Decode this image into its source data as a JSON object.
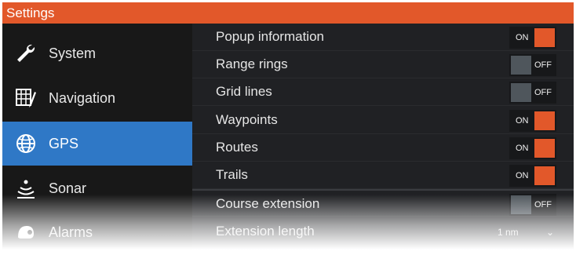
{
  "window": {
    "title": "Settings"
  },
  "sidebar": {
    "items": [
      {
        "label": "System",
        "icon": "wrench-icon",
        "active": false
      },
      {
        "label": "Navigation",
        "icon": "chart-pencil-icon",
        "active": false
      },
      {
        "label": "GPS",
        "icon": "globe-icon",
        "active": true
      },
      {
        "label": "Sonar",
        "icon": "sonar-icon",
        "active": false
      },
      {
        "label": "Alarms",
        "icon": "alarm-icon",
        "active": false
      }
    ]
  },
  "settings": {
    "rows": [
      {
        "label": "Popup information",
        "control": "toggle",
        "state": "ON"
      },
      {
        "label": "Range rings",
        "control": "toggle",
        "state": "OFF"
      },
      {
        "label": "Grid lines",
        "control": "toggle",
        "state": "OFF"
      },
      {
        "label": "Waypoints",
        "control": "toggle",
        "state": "ON"
      },
      {
        "label": "Routes",
        "control": "toggle",
        "state": "ON"
      },
      {
        "label": "Trails",
        "control": "toggle",
        "state": "ON"
      },
      {
        "label": "Course extension",
        "control": "toggle",
        "state": "OFF"
      },
      {
        "label": "Extension length",
        "control": "dropdown",
        "value": "1 nm"
      }
    ]
  },
  "colors": {
    "accent": "#e2582a",
    "active_nav": "#2f78c6",
    "toggle_off_knob": "#4f565c",
    "background": "#202124"
  }
}
